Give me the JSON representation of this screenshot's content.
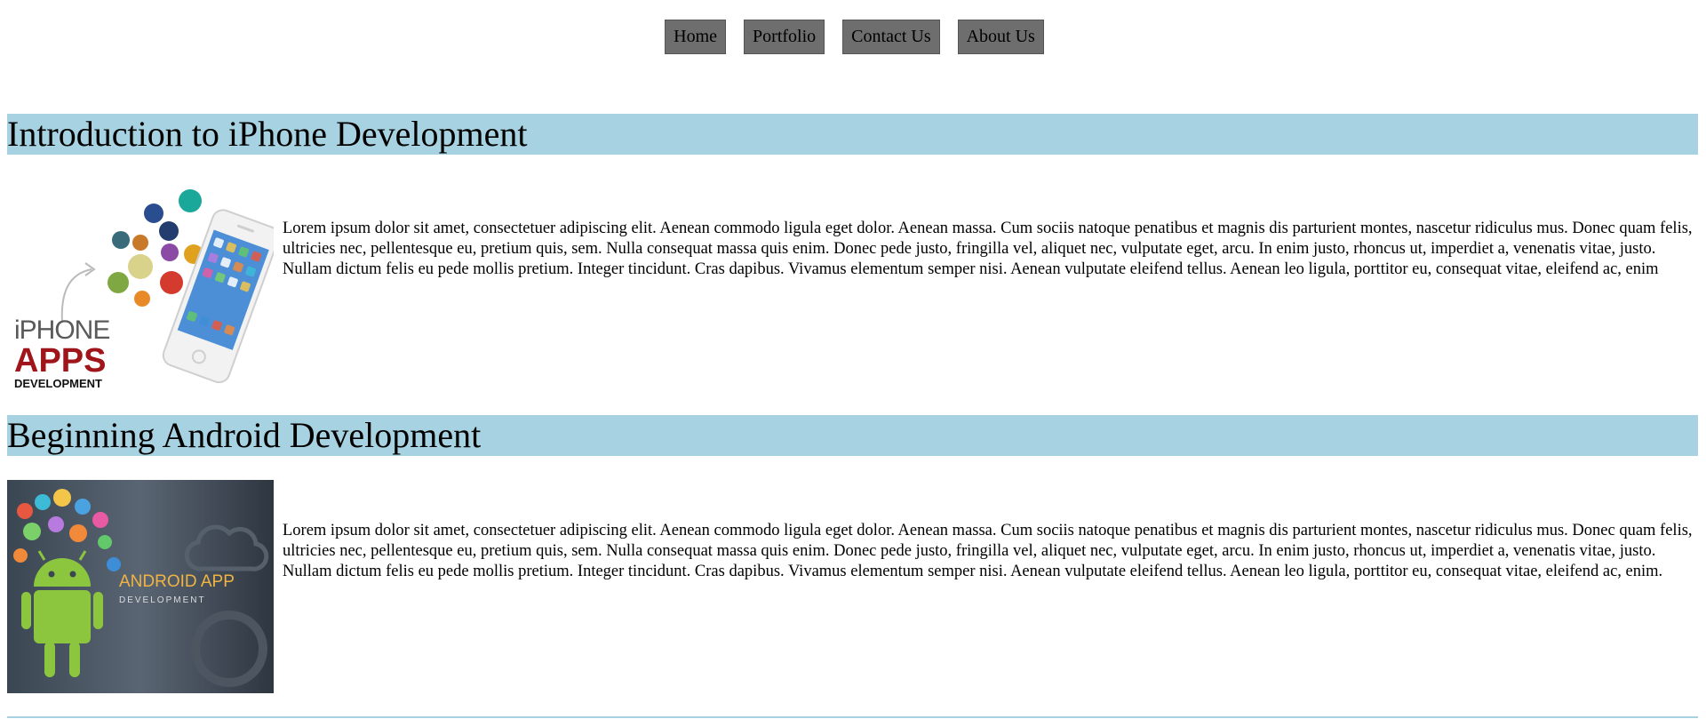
{
  "nav": {
    "items": [
      {
        "label": "Home"
      },
      {
        "label": "Portfolio"
      },
      {
        "label": "Contact Us"
      },
      {
        "label": "About Us"
      }
    ]
  },
  "sections": [
    {
      "title": "Introduction to iPhone Development",
      "image": {
        "line1": "iPHONE",
        "line2": "APPS",
        "line3": "DEVELOPMENT"
      },
      "body": "Lorem ipsum dolor sit amet, consectetuer adipiscing elit. Aenean commodo ligula eget dolor. Aenean massa. Cum sociis natoque penatibus et magnis dis parturient montes, nascetur ridiculus mus. Donec quam felis, ultricies nec, pellentesque eu, pretium quis, sem. Nulla consequat massa quis enim. Donec pede justo, fringilla vel, aliquet nec, vulputate eget, arcu. In enim justo, rhoncus ut, imperdiet a, venenatis vitae, justo. Nullam dictum felis eu pede mollis pretium. Integer tincidunt. Cras dapibus. Vivamus elementum semper nisi. Aenean vulputate eleifend tellus. Aenean leo ligula, porttitor eu, consequat vitae, eleifend ac, enim"
    },
    {
      "title": "Beginning Android Development",
      "image": {
        "line1": "ANDROID APP",
        "line2": "DEVELOPMENT"
      },
      "body": "Lorem ipsum dolor sit amet, consectetuer adipiscing elit. Aenean commodo ligula eget dolor. Aenean massa. Cum sociis natoque penatibus et magnis dis parturient montes, nascetur ridiculus mus. Donec quam felis, ultricies nec, pellentesque eu, pretium quis, sem. Nulla consequat massa quis enim. Donec pede justo, fringilla vel, aliquet nec, vulputate eget, arcu. In enim justo, rhoncus ut, imperdiet a, venenatis vitae, justo. Nullam dictum felis eu pede mollis pretium. Integer tincidunt. Cras dapibus. Vivamus elementum semper nisi. Aenean vulputate eleifend tellus. Aenean leo ligula, porttitor eu, consequat vitae, eleifend ac, enim."
    }
  ],
  "colors": {
    "heading_bg": "#a6d2e1",
    "nav_bg": "#6e6e6e",
    "apps_red": "#a0151a",
    "android_green": "#8cc63f"
  }
}
